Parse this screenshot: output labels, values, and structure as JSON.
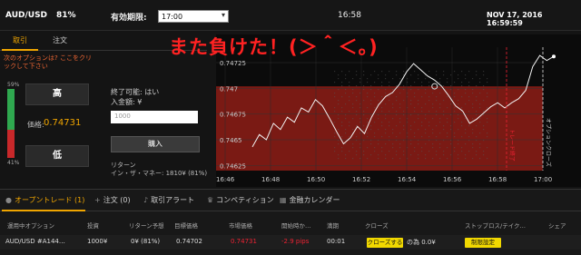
{
  "header": {
    "pair": "AUD/USD",
    "percent": "81%",
    "expiry_label": "有効期限:",
    "expiry_value": "17:00",
    "clock": "16:58",
    "datetime": "NOV 17, 2016 16:59:59"
  },
  "left_tabs": [
    {
      "label": "取引",
      "active": true
    },
    {
      "label": "注文",
      "active": false
    }
  ],
  "notice": "次のオプションは? ここをクリックして下さい",
  "sentiment": {
    "up_pct": "59%",
    "down_pct": "41%",
    "up_value": 59,
    "label": "トレーダー心理"
  },
  "high_button": "高",
  "low_button": "低",
  "price_label": "価格:",
  "price_value": "0.74731",
  "trade": {
    "expirable": "終了可能: はい",
    "amount_label": "入金額: ¥",
    "amount_placeholder": "1000",
    "buy_label": "購入",
    "return_label": "リターン",
    "in_the_money": "イン・ザ・マネー: 1810¥ (81%)"
  },
  "annotation": "また負けた！(＞＾＜。)",
  "chart_data": {
    "type": "line",
    "x_ticks": [
      "16:46",
      "16:48",
      "16:50",
      "16:52",
      "16:54",
      "16:56",
      "16:58",
      "17:00"
    ],
    "y_ticks": [
      "0.74725",
      "0.747",
      "0.74675",
      "0.7465",
      "0.74625"
    ],
    "ylim": [
      0.7462,
      0.7474
    ],
    "strike": 0.74702,
    "series": [
      {
        "values": [
          0.74643,
          0.74655,
          0.7465,
          0.74666,
          0.7466,
          0.74672,
          0.74667,
          0.74681,
          0.74677,
          0.74689,
          0.74683,
          0.74671,
          0.74658,
          0.74646,
          0.74652,
          0.74663,
          0.74656,
          0.74672,
          0.74684,
          0.74692,
          0.74696,
          0.74704,
          0.74716,
          0.74724,
          0.74718,
          0.74712,
          0.74708,
          0.74702,
          0.74693,
          0.74683,
          0.74678,
          0.74666,
          0.7467,
          0.74676,
          0.74682,
          0.74686,
          0.74681,
          0.74686,
          0.7469,
          0.74698,
          0.74721,
          0.74732,
          0.74727,
          0.74731
        ]
      }
    ],
    "markers": {
      "trade_close": "トレード終了",
      "option_close": "オプションクローズ"
    }
  },
  "bottom_tabs": [
    {
      "label": "オープントレード (1)",
      "icon": "dot-icon",
      "active": true
    },
    {
      "label": "注文 (0)",
      "icon": "plus-icon",
      "active": false
    },
    {
      "label": "取引アラート",
      "icon": "bell-icon",
      "active": false
    },
    {
      "label": "コンペティション",
      "icon": "trophy-icon",
      "active": false
    },
    {
      "label": "金融カレンダー",
      "icon": "calendar-icon",
      "active": false
    }
  ],
  "table": {
    "headers": [
      "運用中オプション",
      "投資",
      "リターン予想",
      "目標価格",
      "市場価格",
      "開始時か…",
      "満期",
      "クローズ",
      "ストップロス/テイク…",
      "シェア"
    ],
    "row": {
      "option": "AUD/USD #A144…",
      "invest": "1000¥",
      "expected": "0¥ (81%)",
      "target": "0.74702",
      "market": "0.74731",
      "pips": "-2.9 pips",
      "expiry": "00:01",
      "close_btn": "クローズする",
      "close_text": "の為 0.0¥",
      "settings_btn": "制限設定"
    }
  }
}
